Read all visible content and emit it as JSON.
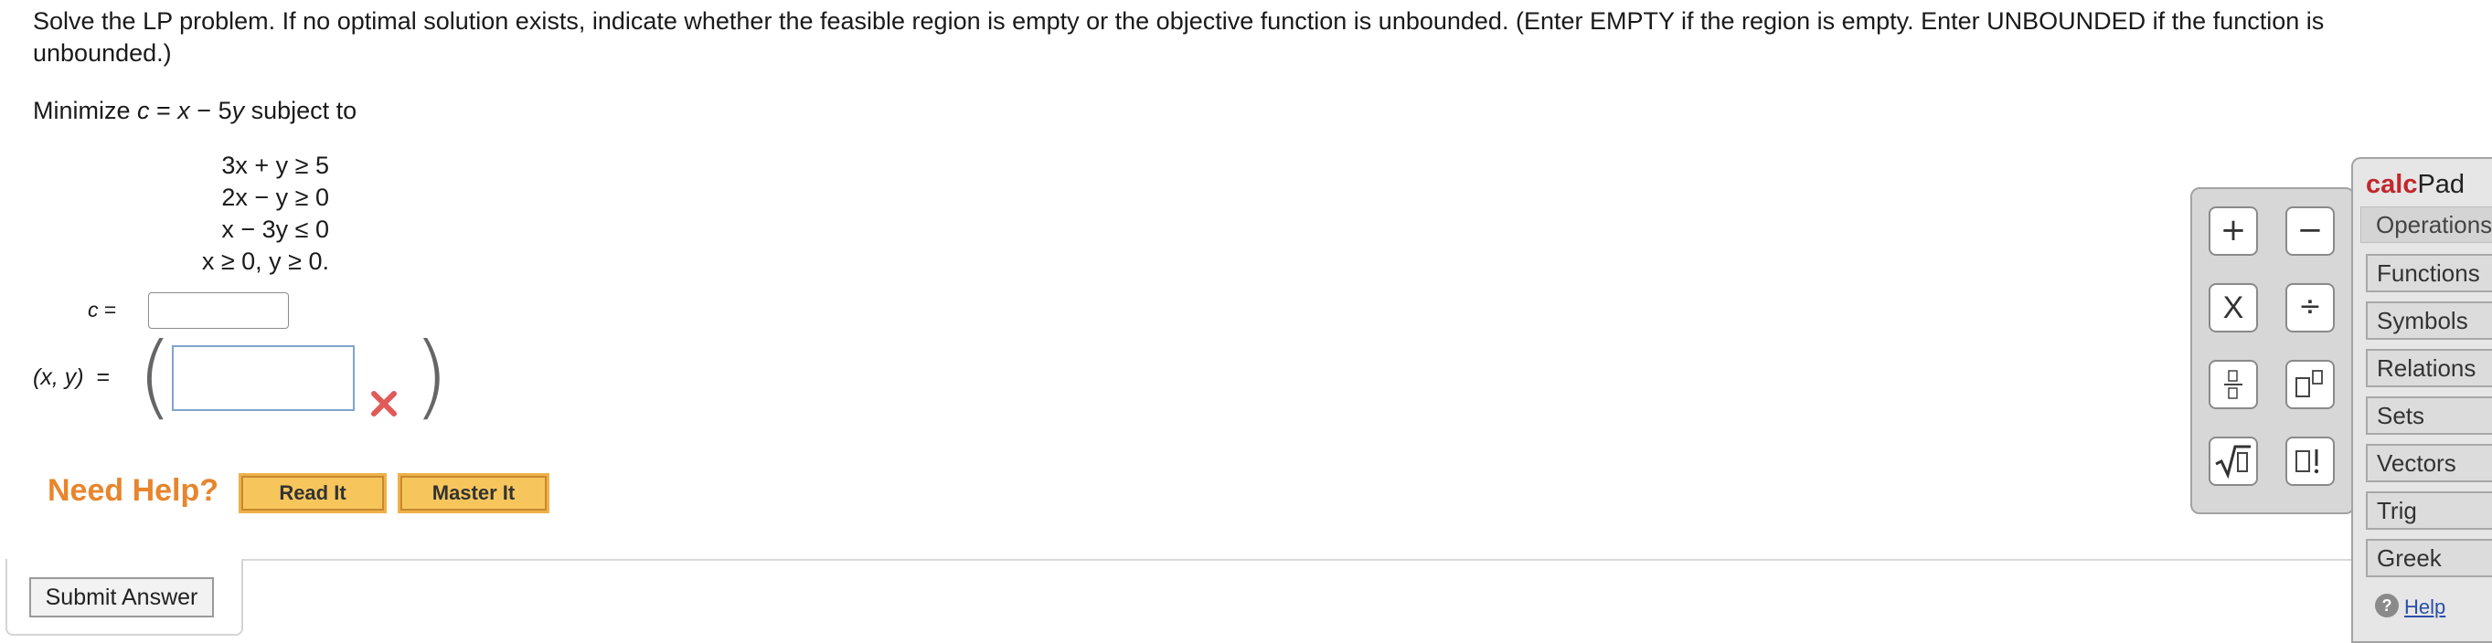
{
  "problem": {
    "text": "Solve the LP problem. If no optimal solution exists, indicate whether the feasible region is empty or the objective function is unbounded. (Enter EMPTY if the region is empty. Enter UNBOUNDED if the function is unbounded.)",
    "objective_prefix": "Minimize ",
    "objective_var": "c",
    "objective_eq": " = ",
    "objective_expr_x": "x",
    "objective_expr_mid": " − 5",
    "objective_expr_y": "y",
    "objective_suffix": " subject to",
    "constraints": [
      "3x + y ≥ 5",
      "2x − y ≥ 0",
      "x − 3y ≤ 0",
      "x ≥ 0, y ≥ 0."
    ]
  },
  "answer": {
    "c_label": "c",
    "eq_label": "=",
    "xy_label": "(x, y)",
    "c_value": "",
    "xy_value": "",
    "status": "incorrect"
  },
  "help": {
    "need_help": "Need Help?",
    "read_it": "Read It",
    "master_it": "Master It"
  },
  "submit": {
    "label": "Submit Answer"
  },
  "calcpad": {
    "title_part1": "calc",
    "title_part2": "Pad",
    "active_tab": "Operations",
    "tabs": [
      "Functions",
      "Symbols",
      "Relations",
      "Sets",
      "Vectors",
      "Trig",
      "Greek"
    ],
    "help_label": "Help",
    "operations": [
      {
        "icon": "plus-icon",
        "glyph": "+"
      },
      {
        "icon": "minus-icon",
        "glyph": "−"
      },
      {
        "icon": "multiply-icon",
        "glyph": "X"
      },
      {
        "icon": "divide-icon",
        "glyph": "÷"
      },
      {
        "icon": "fraction-icon",
        "glyph": "▯/▯"
      },
      {
        "icon": "exponent-icon",
        "glyph": "▯▯"
      },
      {
        "icon": "square-root-icon",
        "glyph": "√▯"
      },
      {
        "icon": "factorial-icon",
        "glyph": "▯!"
      }
    ],
    "colors": {
      "title_accent": "#c0282e",
      "panel_bg": "#e6e6e6"
    }
  },
  "colors": {
    "need_help": "#e8852d",
    "help_button": "#f6c65d",
    "error_mark": "#e05a57"
  }
}
